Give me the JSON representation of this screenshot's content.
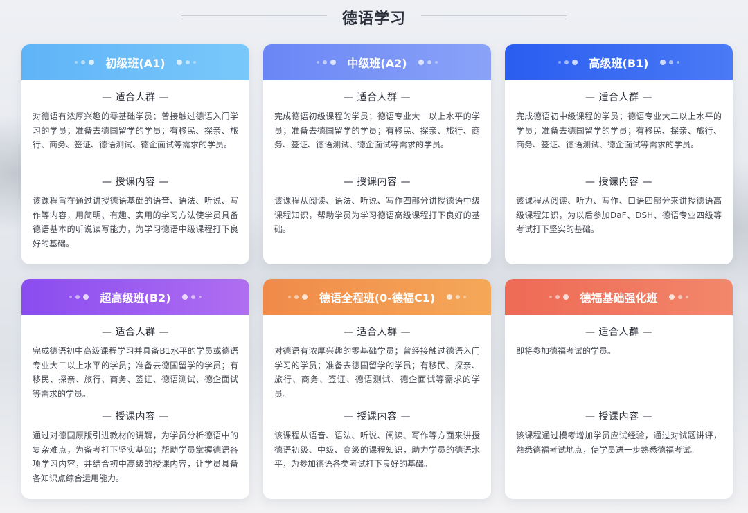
{
  "page_title": "德语学习",
  "colors": {
    "a1": "#6ab8f9",
    "a2": "#7a94f6",
    "b1": "#3468f2",
    "b2": "#9c5cf0",
    "c1": "#f29a50",
    "testdaf": "#f07860"
  },
  "cards": [
    {
      "title": "初级班(A1)",
      "audience_heading": "— 适合人群 —",
      "audience_text": "对德语有浓厚兴趣的零基础学员；曾接触过德语入门学习的学员；准备去德国留学的学员；有移民、探亲、旅行、商务、签证、德语测试、德企面试等需求的学员。",
      "content_heading": "— 授课内容 —",
      "content_text": "该课程旨在通过讲授德语基础的语音、语法、听说、写作等内容，用简明、有趣、实用的学习方法使学员具备德语基本的听说读写能力，为学习德语中级课程打下良好的基础。"
    },
    {
      "title": "中级班(A2)",
      "audience_heading": "— 适合人群 —",
      "audience_text": "完成德语初级课程的学员；德语专业大一以上水平的学员；准备去德国留学的学员；有移民、探亲、旅行、商务、签证、德语测试、德企面试等需求的学员。",
      "content_heading": "— 授课内容 —",
      "content_text": "该课程从阅读、语法、听说、写作四部分讲授德语中级课程知识，帮助学员为学习德语高级课程打下良好的基础。"
    },
    {
      "title": "高级班(B1)",
      "audience_heading": "— 适合人群 —",
      "audience_text": "完成德语初中级课程的学员；德语专业大二以上水平的学员；准备去德国留学的学员；有移民、探亲、旅行、商务、签证、德语测试、德企面试等需求的学员。",
      "content_heading": "— 授课内容 —",
      "content_text": "该课程从阅读、听力、写作、口语四部分来讲授德语高级课程知识，为以后参加DaF、DSH、德语专业四级等考试打下坚实的基础。"
    },
    {
      "title": "超高级班(B2)",
      "audience_heading": "— 适合人群 —",
      "audience_text": "完成德语初中高级课程学习并具备B1水平的学员或德语专业大二以上水平的学员；准备去德国留学的学员；有移民、探亲、旅行、商务、签证、德语测试、德企面试等需求的学员。",
      "content_heading": "— 授课内容 —",
      "content_text": "通过对德国原版引进教材的讲解，为学员分析德语中的复杂难点，为备考打下坚实基础；帮助学员掌握德语各项学习内容，并结合初中高级的授课内容，让学员具备各知识点综合运用能力。"
    },
    {
      "title": "德语全程班(0-德福C1)",
      "audience_heading": "— 适合人群 —",
      "audience_text": "对德语有浓厚兴趣的零基础学员；曾经接触过德语入门学习的学员；准备去德国留学的学员；有移民、探亲、旅行、商务、签证、德语测试、德企面试等需求的学员。",
      "content_heading": "— 授课内容 —",
      "content_text": "该课程从语音、语法、听说、阅读、写作等方面来讲授德语初级、中级、高级的课程知识，助力学员的德语水平，为参加德语各类考试打下良好的基础。"
    },
    {
      "title": "德福基础强化班",
      "audience_heading": "— 适合人群 —",
      "audience_text": "即将参加德福考试的学员。",
      "content_heading": "— 授课内容 —",
      "content_text": "该课程通过模考增加学员应试经验，通过对试题讲评，熟悉德福考试地点，使学员进一步熟悉德福考试。"
    }
  ]
}
